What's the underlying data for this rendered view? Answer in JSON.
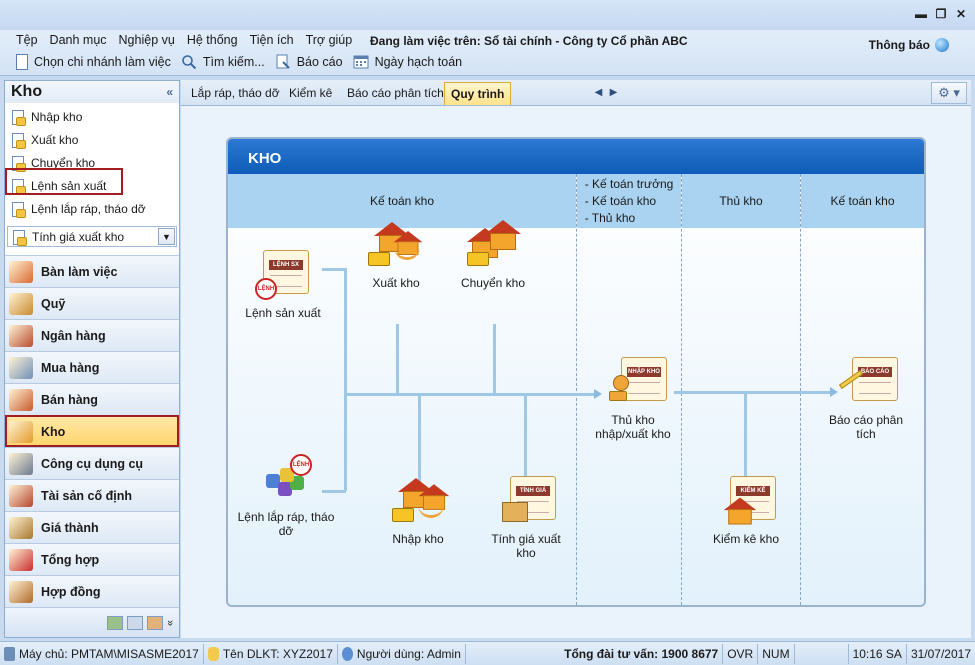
{
  "window": {
    "minimize": "▬",
    "restore": "❐",
    "close": "✕"
  },
  "menu": {
    "items": [
      "Tệp",
      "Danh mục",
      "Nghiệp vụ",
      "Hệ thống",
      "Tiện ích",
      "Trợ giúp"
    ],
    "working_on": "Đang làm việc trên: Sổ tài chính - Công ty Cổ phần ABC",
    "notification": "Thông báo"
  },
  "toolbar": {
    "branch": "Chọn chi nhánh làm việc",
    "search": "Tìm kiếm...",
    "report": "Báo cáo",
    "posting_date": "Ngày hạch toán"
  },
  "sidebar": {
    "title": "Kho",
    "collapse": "«",
    "items": [
      {
        "label": "Nhập kho"
      },
      {
        "label": "Xuất kho"
      },
      {
        "label": "Chuyển kho"
      },
      {
        "label": "Lệnh sản xuất"
      },
      {
        "label": "Lệnh lắp ráp, tháo dỡ"
      }
    ],
    "combo": "Tính giá xuất kho",
    "combo_arrow": "▼",
    "modules": [
      {
        "label": "Bàn làm việc",
        "color": "#d9692f"
      },
      {
        "label": "Quỹ",
        "color": "#c98a2b"
      },
      {
        "label": "Ngân hàng",
        "color": "#b74b2e"
      },
      {
        "label": "Mua hàng",
        "color": "#6f8fb7"
      },
      {
        "label": "Bán hàng",
        "color": "#c85a2a"
      },
      {
        "label": "Kho",
        "color": "#e29a27"
      },
      {
        "label": "Công cụ dụng cụ",
        "color": "#6b7a8e"
      },
      {
        "label": "Tài sản cố định",
        "color": "#b5462f"
      },
      {
        "label": "Giá thành",
        "color": "#a7772c"
      },
      {
        "label": "Tổng hợp",
        "color": "#c92c2c"
      },
      {
        "label": "Hợp đồng",
        "color": "#b06a2a"
      }
    ],
    "more": "»"
  },
  "tabs": {
    "items": [
      "Lắp ráp, tháo dỡ",
      "Kiểm kê",
      "Báo cáo phân tích",
      "Quy trình"
    ],
    "prev": "◀",
    "next": "▶",
    "settings": "⚙ ▾"
  },
  "flow": {
    "title": "KHO",
    "columns": {
      "accountant": "Kế toán kho",
      "roles": [
        "- Kế toán trưởng",
        "- Kế toán kho",
        "- Thủ kho"
      ],
      "storekeeper": "Thủ kho",
      "accountant2": "Kế toán kho"
    },
    "nodes": {
      "lenh_sx": "Lệnh sản xuất",
      "lenh_sx_tag": "LỆNH SX",
      "lenh_stamp": "LỆNH",
      "xuat_kho": "Xuất kho",
      "chuyen_kho": "Chuyển kho",
      "lenh_lr": "Lệnh lắp ráp, tháo dỡ",
      "nhap_kho": "Nhập kho",
      "tinh_gia": "Tính giá xuất kho",
      "tinh_gia_tag": "TÍNH GIÁ",
      "thu_kho": "Thủ kho nhập/xuất kho",
      "nhap_kho_tag": "NHẬP KHO",
      "kiem_ke": "Kiểm kê kho",
      "kiem_ke_tag": "KIỂM KÊ",
      "bao_cao": "Báo cáo phân tích",
      "bao_cao_tag": "BÁO CÁO"
    }
  },
  "status": {
    "server": "Máy chủ: PMTAM\\MISASME2017",
    "db": "Tên DLKT: XYZ2017",
    "user": "Người dùng: Admin",
    "hotline": "Tổng đài tư vấn: 1900 8677",
    "ovr": "OVR",
    "num": "NUM",
    "time": "10:16 SA",
    "date": "31/07/2017"
  }
}
